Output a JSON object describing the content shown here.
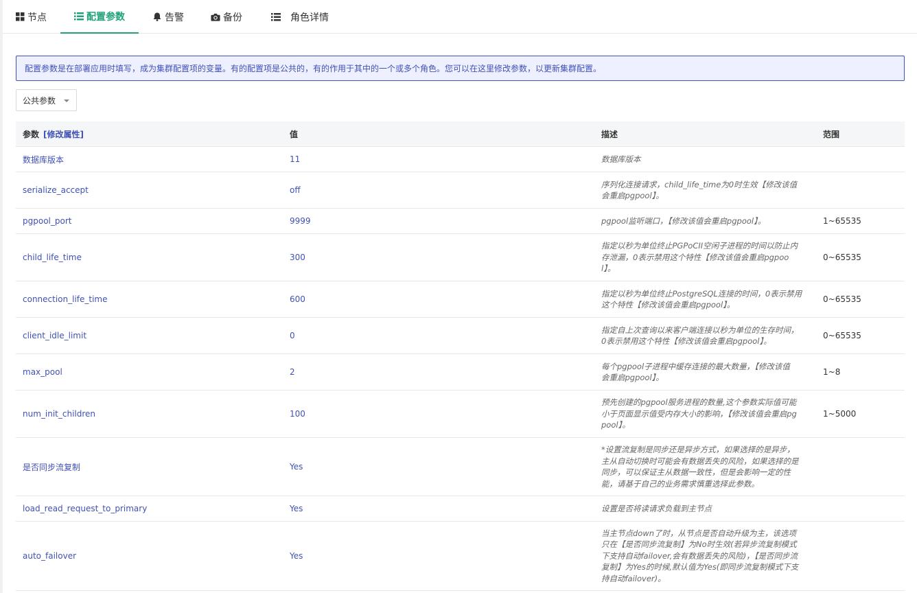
{
  "tabs": [
    {
      "label": "节点",
      "icon": "grid-icon"
    },
    {
      "label": "配置参数",
      "icon": "list-icon"
    },
    {
      "label": "告警",
      "icon": "bell-icon"
    },
    {
      "label": "备份",
      "icon": "camera-icon"
    },
    {
      "label": "角色详情",
      "icon": "list-icon"
    }
  ],
  "notice": "配置参数是在部署应用时填写，成为集群配置项的变量。有的配置项是公共的，有的作用于其中的一个或多个角色。您可以在这里修改参数，以更新集群配置。",
  "filter": {
    "selected": "公共参数"
  },
  "table": {
    "headers": {
      "param": "参数",
      "modify": "[修改属性]",
      "value": "值",
      "desc": "描述",
      "range": "范围"
    },
    "rows": [
      {
        "name": "数据库版本",
        "value": "11",
        "desc": [
          "数据库版本"
        ],
        "range": ""
      },
      {
        "name": "serialize_accept",
        "value": "off",
        "desc": [
          "序列化连接请求，child_life_time为0时生效【修改该值",
          "会重启pgpool】。"
        ],
        "range": ""
      },
      {
        "name": "pgpool_port",
        "value": "9999",
        "desc": [
          "pgpool监听端口，【修改该值会重启pgpool】。"
        ],
        "range": "1~65535"
      },
      {
        "name": "child_life_time",
        "value": "300",
        "desc": [
          "指定以秒为单位终止PGPoCII空闲子进程的时间以防止内",
          "存泄漏，0表示禁用这个特性【修改该值会重启pgpoo",
          "l】。"
        ],
        "range": "0~65535"
      },
      {
        "name": "connection_life_time",
        "value": "600",
        "desc": [
          "指定以秒为单位终止PostgreSQL连接的时间，0表示禁用",
          "这个特性【修改该值会重启pgpool】。"
        ],
        "range": "0~65535"
      },
      {
        "name": "client_idle_limit",
        "value": "0",
        "desc": [
          "指定自上次查询以来客户端连接以秒为单位的生存时间，",
          "0表示禁用这个特性【修改该值会重启pgpool】。"
        ],
        "range": "0~65535"
      },
      {
        "name": "max_pool",
        "value": "2",
        "desc": [
          "每个pgpool子进程中缓存连接的最大数量，【修改该值",
          "会重启pgpool】。"
        ],
        "range": "1~8"
      },
      {
        "name": "num_init_children",
        "value": "100",
        "desc": [
          "预先创建的pgpool服务进程的数量,这个参数实际值可能",
          "小于页面显示值受内存大小的影响，【修改该值会重启pg",
          "pool】。"
        ],
        "range": "1~5000"
      },
      {
        "name": "是否同步流复制",
        "value": "Yes",
        "desc": [
          "*设置流复制是同步还是异步方式，如果选择的是异步，",
          "主从自动切换时可能会有数据丢失的风险，如果选择的是",
          "同步，可以保证主从数据一致性，但是会影响一定的性",
          "能，请基于自己的业务需求慎重选择此参数。"
        ],
        "range": ""
      },
      {
        "name": "load_read_request_to_primary",
        "value": "Yes",
        "desc": [
          "设置是否将读请求负载到主节点"
        ],
        "range": ""
      },
      {
        "name": "auto_failover",
        "value": "Yes",
        "desc": [
          "当主节点down了时，从节点是否自动升级为主，该选项",
          "只在【是否同步流复制】为No时生效(若异步流复制模式",
          "下支持自动failover,会有数据丢失的风险)，【是否同步流",
          "复制】为Yes的时候,默认值为Yes(即同步流复制模式下支",
          "持自动failover)。"
        ],
        "range": ""
      }
    ]
  }
}
